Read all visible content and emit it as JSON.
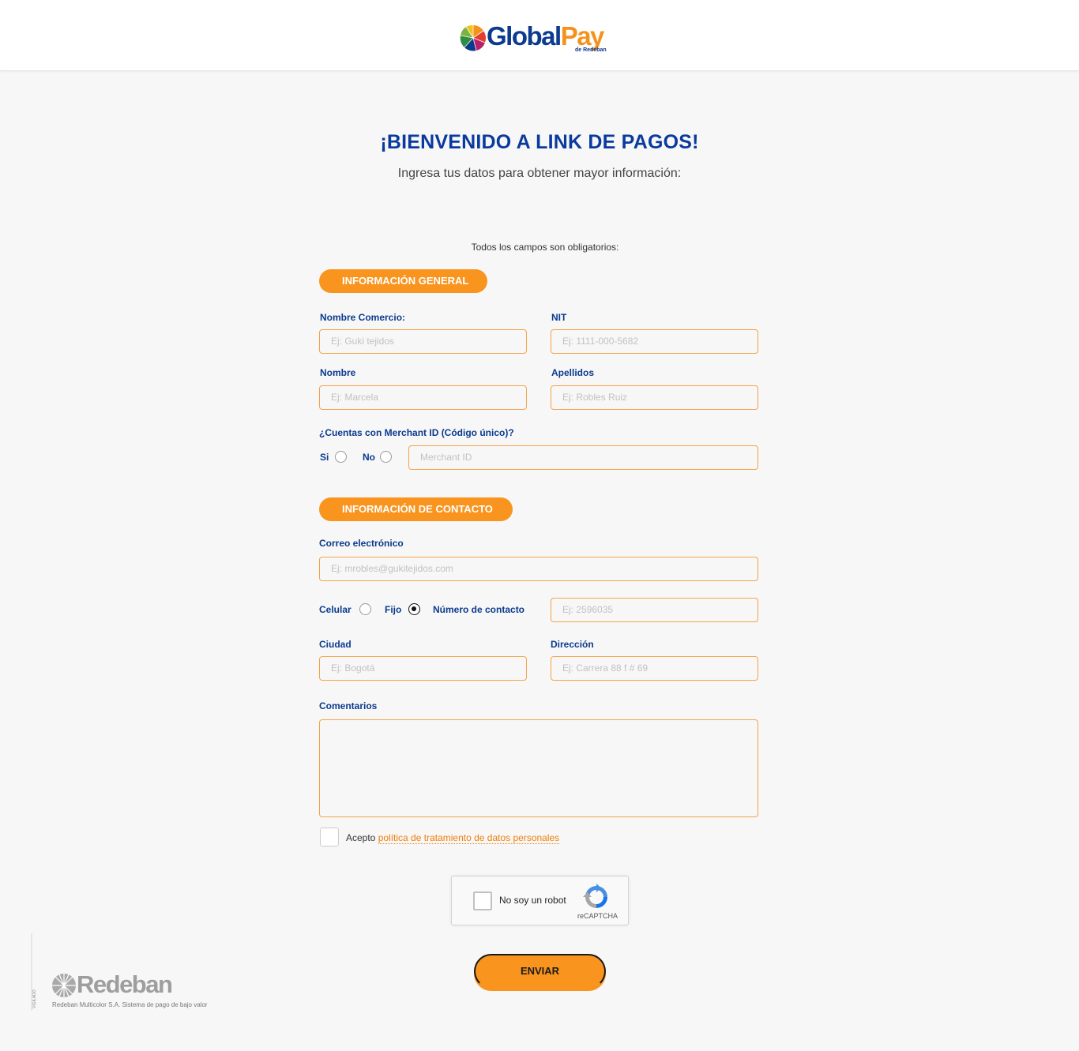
{
  "header": {
    "logo_main": "Global",
    "logo_accent": "Pay",
    "logo_sub": "de Redeban"
  },
  "main": {
    "title": "¡BIENVENIDO A LINK DE PAGOS!",
    "subtitle": "Ingresa tus datos para obtener mayor información:",
    "required_note": "Todos los campos son obligatorios:"
  },
  "general": {
    "section_label": "INFORMACIÓN GENERAL",
    "nombre_comercio": {
      "label": "Nombre Comercio:",
      "placeholder": "Ej: Guki tejidos"
    },
    "nit": {
      "label": "NIT",
      "placeholder": "Ej: 1111-000-5682"
    },
    "nombre": {
      "label": "Nombre",
      "placeholder": "Ej: Marcela"
    },
    "apellidos": {
      "label": "Apellidos",
      "placeholder": "Ej: Robles Ruiz"
    },
    "merchant_question": "¿Cuentas con Merchant  ID (Código único)?",
    "merchant_si": "Si",
    "merchant_no": "No",
    "merchant_placeholder": "Merchant ID"
  },
  "contact": {
    "section_label": "INFORMACIÓN DE CONTACTO",
    "email": {
      "label": "Correo electrónico",
      "placeholder": "Ej: mrobles@gukitejidos.com"
    },
    "celular_label": "Celular",
    "fijo_label": "Fijo",
    "numero_label": "Número de contacto",
    "numero_placeholder": "Ej: 2596035",
    "selected_phone_type": "Fijo",
    "ciudad": {
      "label": "Ciudad",
      "placeholder": "Ej: Bogotá"
    },
    "direccion": {
      "label": "Dirección",
      "placeholder": "Ej: Carrera 88 f # 69"
    },
    "comentarios_label": "Comentarios",
    "accept_text": "Acepto",
    "accept_link": "política de tratamiento de datos personales"
  },
  "captcha": {
    "label": "No soy un robot",
    "brand": "reCAPTCHA"
  },
  "submit_label": "ENVIAR",
  "footer": {
    "brand": "Redeban",
    "tagline": "Redeban Multicolor S.A. Sistema de pago de bajo valor",
    "vigilado": "VIGILADO"
  },
  "colors": {
    "primary_blue": "#0b3a8e",
    "accent_orange": "#f9941e"
  }
}
